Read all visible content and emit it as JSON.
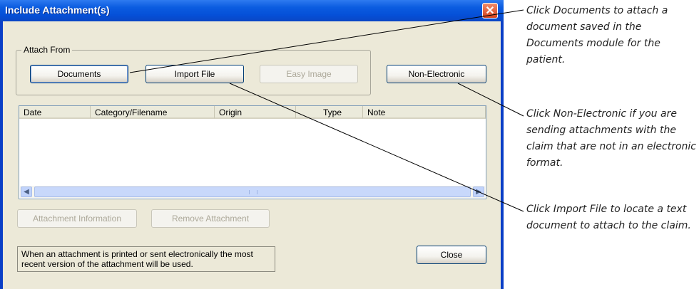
{
  "dialog": {
    "title": "Include Attachment(s)",
    "close_glyph": "✕",
    "attach_group_label": "Attach From",
    "buttons": {
      "documents": "Documents",
      "import_file": "Import File",
      "easy_image": "Easy Image",
      "non_electronic": "Non-Electronic",
      "attachment_information": "Attachment Information",
      "remove_attachment": "Remove Attachment",
      "close": "Close"
    },
    "list": {
      "columns": [
        "Date",
        "Category/Filename",
        "Origin",
        "Type",
        "Note"
      ],
      "rows": []
    },
    "info_text": "When an attachment is printed or sent electronically the most recent version of the attachment will be used."
  },
  "callouts": {
    "documents": "Click Documents to attach a document saved in the Documents module for the patient.",
    "non_electronic": "Click Non-Electronic if you are sending attachments with the claim that are not in an electronic format.",
    "import_file": "Click Import File to locate a text document to attach to the claim."
  },
  "colors": {
    "title_bar": "#0a5ce0",
    "dialog_face": "#ece9d8",
    "close_button": "#d6431d"
  }
}
